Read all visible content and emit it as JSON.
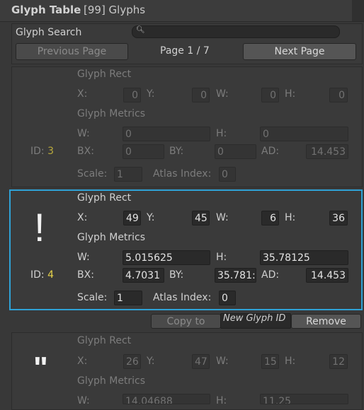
{
  "header": {
    "title": "Glyph Table",
    "count": "[99] Glyphs"
  },
  "search": {
    "label": "Glyph Search",
    "value": ""
  },
  "pagination": {
    "prev_label": "Previous Page",
    "page_text": "Page 1 / 7",
    "next_label": "Next Page"
  },
  "labels": {
    "glyph_rect": "Glyph Rect",
    "glyph_metrics": "Glyph Metrics",
    "x": "X:",
    "y": "Y:",
    "w": "W:",
    "h": "H:",
    "bx": "BX:",
    "by": "BY:",
    "ad": "AD:",
    "scale": "Scale:",
    "atlas_index": "Atlas Index:",
    "id": "ID:"
  },
  "glyphs": [
    {
      "char": "",
      "id": "3",
      "rect": {
        "x": "0",
        "y": "0",
        "w": "0",
        "h": "0"
      },
      "metrics": {
        "w": "0",
        "h": "0",
        "bx": "0",
        "by": "0",
        "ad": "14.453"
      },
      "scale": "1",
      "atlas_index": "0"
    },
    {
      "char": "!",
      "id": "4",
      "rect": {
        "x": "49",
        "y": "45",
        "w": "6",
        "h": "36"
      },
      "metrics": {
        "w": "5.015625",
        "h": "35.78125",
        "bx": "4.7031",
        "by": "35.781:",
        "ad": "14.453"
      },
      "scale": "1",
      "atlas_index": "0"
    },
    {
      "char": "\"",
      "rect": {
        "x": "26",
        "y": "47",
        "w": "15",
        "h": "12"
      },
      "metrics": {
        "w": "14.04688",
        "h": "11.25"
      }
    }
  ],
  "actions": {
    "copy_to_label": "Copy to",
    "new_glyph_id_placeholder": "New Glyph ID",
    "remove_label": "Remove"
  },
  "icons": {
    "search": "search-icon"
  },
  "colors": {
    "selection": "#2fa2d6",
    "id_value": "#e6d24a",
    "panel_bg": "#383838"
  }
}
